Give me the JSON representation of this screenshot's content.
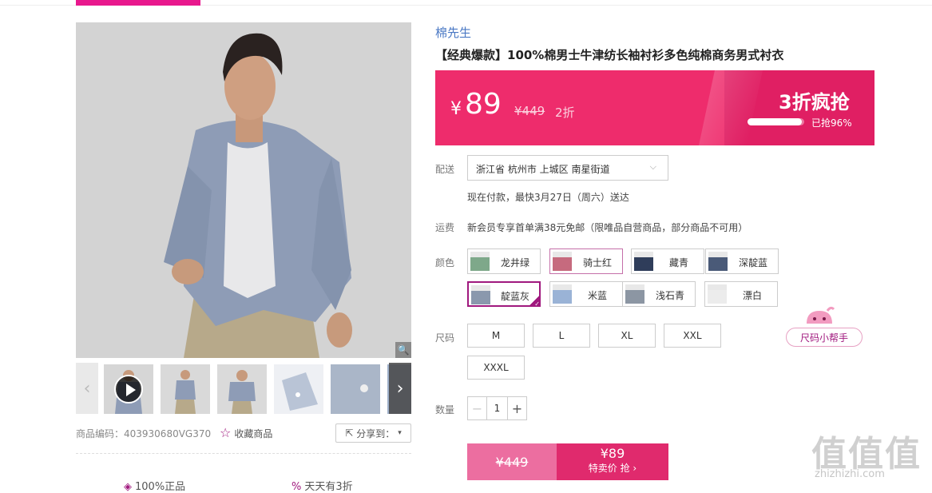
{
  "brand": "棉先生",
  "title": "【经典爆款】100%棉男士牛津纺长袖衬衫多色纯棉商务男式衬衣",
  "price": {
    "currency": "¥",
    "current": "89",
    "original": "¥449",
    "discount": "2折",
    "flash_label": "3折疯抢",
    "sold_text": "已抢96%",
    "sold_fraction": 0.96,
    "colors": {
      "box": "#ee2c6c",
      "accent": "#a0197e"
    }
  },
  "delivery": {
    "label": "配送",
    "address": "浙江省 杭州市 上城区 南星街道",
    "eta": "现在付款，最快3月27日（周六）送达"
  },
  "freight": {
    "label": "运费",
    "text": "新会员专享首单满38元免邮（限唯品自营商品，部分商品不可用）"
  },
  "color": {
    "label": "颜色",
    "options": [
      "龙井绿",
      "骑士红",
      "藏青",
      "深靛蓝",
      "靛蓝灰",
      "米蓝",
      "浅石青",
      "漂白"
    ],
    "selected": "靛蓝灰",
    "swatches": [
      "#7ea88a",
      "#c66a7e",
      "#2f3d5a",
      "#4a5a78",
      "#8a98ad",
      "#9ab3d6",
      "#8c96a3",
      "#ececec"
    ]
  },
  "size": {
    "label": "尺码",
    "options": [
      "M",
      "L",
      "XL",
      "XXL",
      "XXXL"
    ],
    "helper": "尺码小帮手"
  },
  "quantity": {
    "label": "数量",
    "value": "1",
    "minus": "−",
    "plus": "+"
  },
  "buy": {
    "original": "¥449",
    "price": "¥89",
    "action": "特卖价 抢 ›"
  },
  "product_meta": {
    "sku": "商品编码：403930680VG370",
    "favorite": "收藏商品",
    "share": "分享到："
  },
  "promises": [
    "100%正品",
    "天天有3折"
  ],
  "watermark": {
    "mark": "值值值",
    "site": "zhizhizhi.com"
  }
}
